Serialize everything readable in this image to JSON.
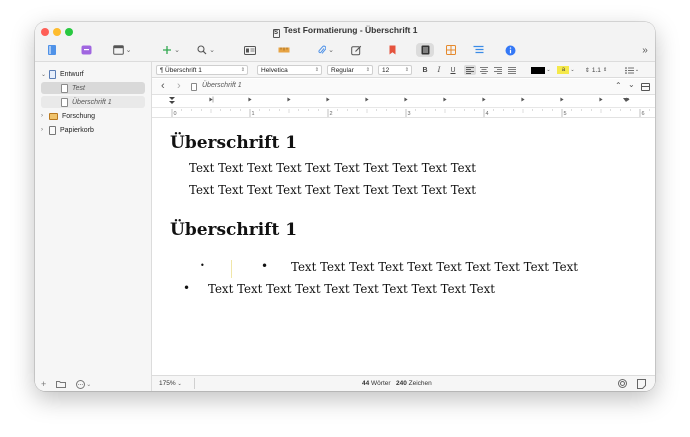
{
  "window": {
    "title": "Test Formatierung - Überschrift 1"
  },
  "sidebar": {
    "items": [
      {
        "label": "Entwurf",
        "icon": "draft-folder-icon"
      },
      {
        "label": "Test",
        "icon": "document-icon"
      },
      {
        "label": "Überschrift 1",
        "icon": "document-icon"
      },
      {
        "label": "Forschung",
        "icon": "research-folder-icon"
      },
      {
        "label": "Papierkorb",
        "icon": "trash-icon"
      }
    ],
    "footer": {
      "add": "+",
      "more": "⋯"
    }
  },
  "format_bar": {
    "style": "Überschrift 1",
    "font": "Helvetica",
    "weight": "Regular",
    "size": "12",
    "bold": "B",
    "italic": "I",
    "underline": "U",
    "line_spacing": "1.1",
    "highlight": "a",
    "text_color": "#000000",
    "highlight_color": "#f5e94a"
  },
  "nav": {
    "back": "‹",
    "forward": "›",
    "path": "Überschrift 1"
  },
  "ruler": {
    "labels": [
      "0",
      "1",
      "2",
      "3",
      "4",
      "5",
      "6"
    ]
  },
  "document": {
    "heading1": "Überschrift 1",
    "para1": "Text Text Text Text Text Text Text Text Text Text",
    "para2": "Text Text Text Text Text Text Text Text Text Text",
    "heading2": "Überschrift 1",
    "bullet_small": "•",
    "bullet_line1": "Text Text Text Text Text Text Text Text Text Text",
    "bullet_line2": "Text Text Text Text Text Text Text Text Text Text"
  },
  "status": {
    "zoom": "175%",
    "words_count": "44",
    "words_label": "Wörter",
    "chars_count": "240",
    "chars_label": "Zeichen"
  },
  "colors": {
    "accent": "#3478f6",
    "close": "#ff5f57",
    "minimize": "#febc2e",
    "maximize": "#28c840"
  }
}
